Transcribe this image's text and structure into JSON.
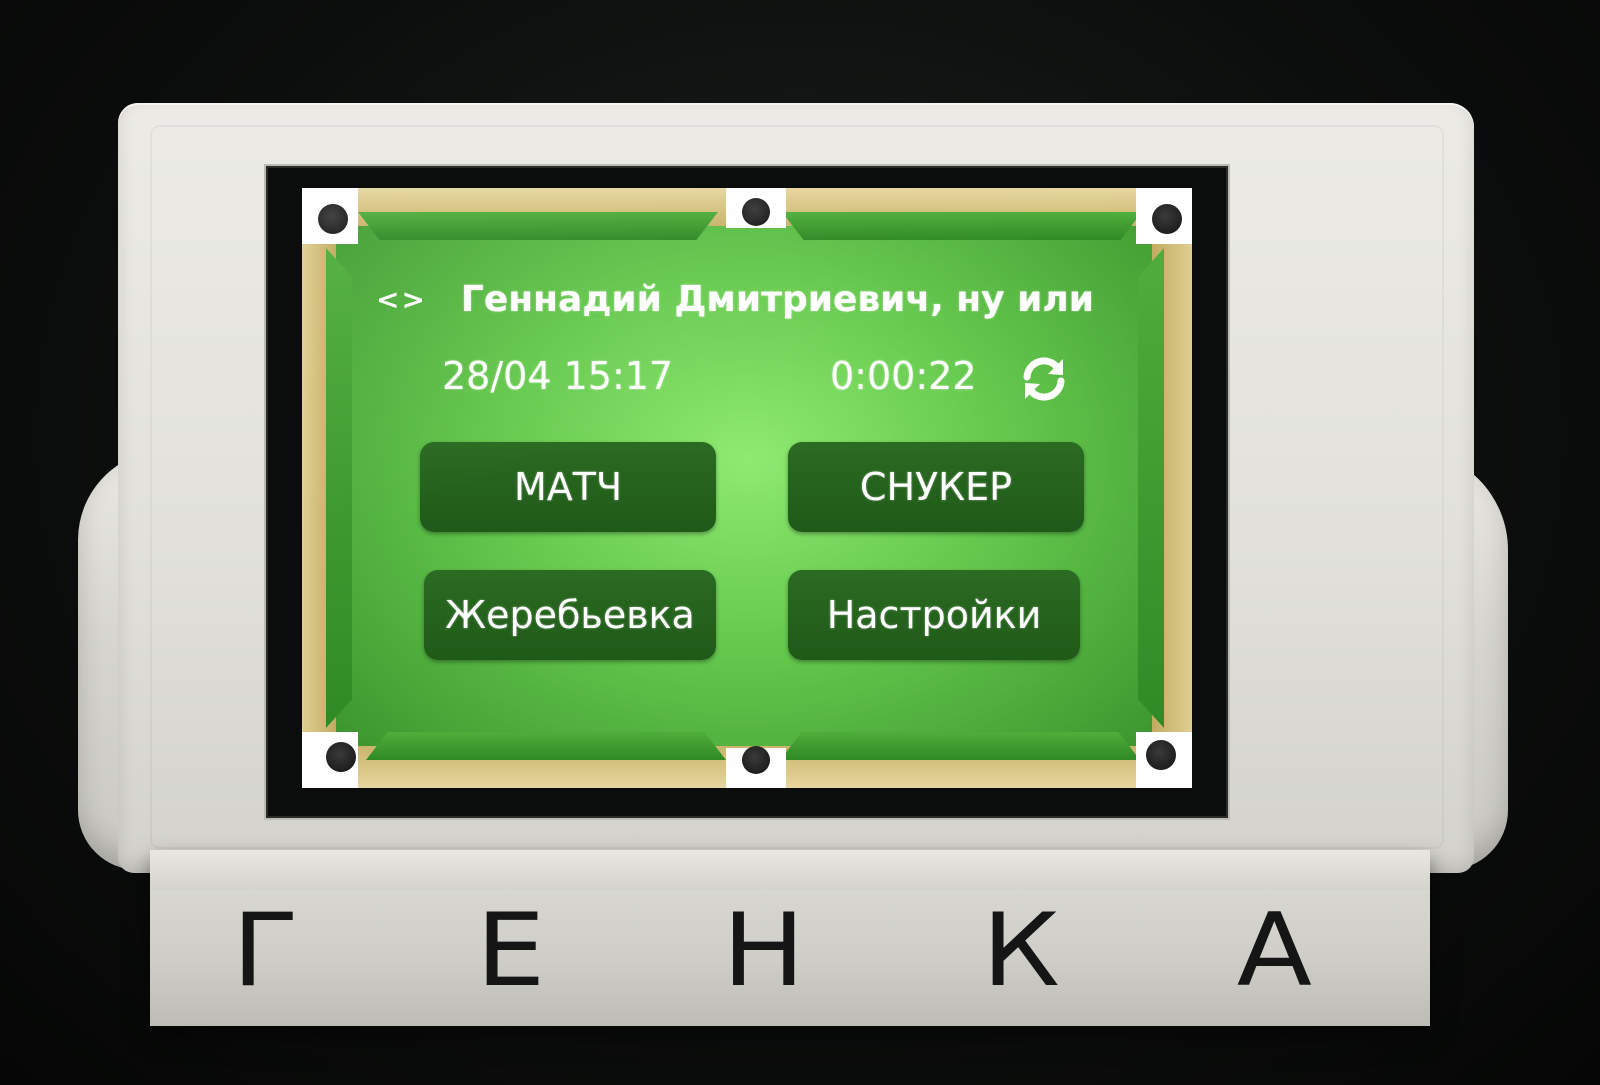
{
  "device": {
    "engraved_label_letters": [
      "Г",
      "Е",
      "Н",
      "К",
      "А"
    ]
  },
  "screen": {
    "marquee": {
      "scroll_icon_text": "<>",
      "text": "Геннадий Дмитриевич, ну или"
    },
    "datetime": "28/04 15:17",
    "timer": "0:00:22",
    "refresh_icon": "refresh-icon",
    "buttons": {
      "match": "МАТЧ",
      "snooker": "СНУКЕР",
      "draw": "Жеребьевка",
      "settings": "Настройки"
    }
  },
  "colors": {
    "felt": "#66c94e",
    "button": "#245f1c",
    "rail": "#d4c07a",
    "text": "#ffffff"
  }
}
